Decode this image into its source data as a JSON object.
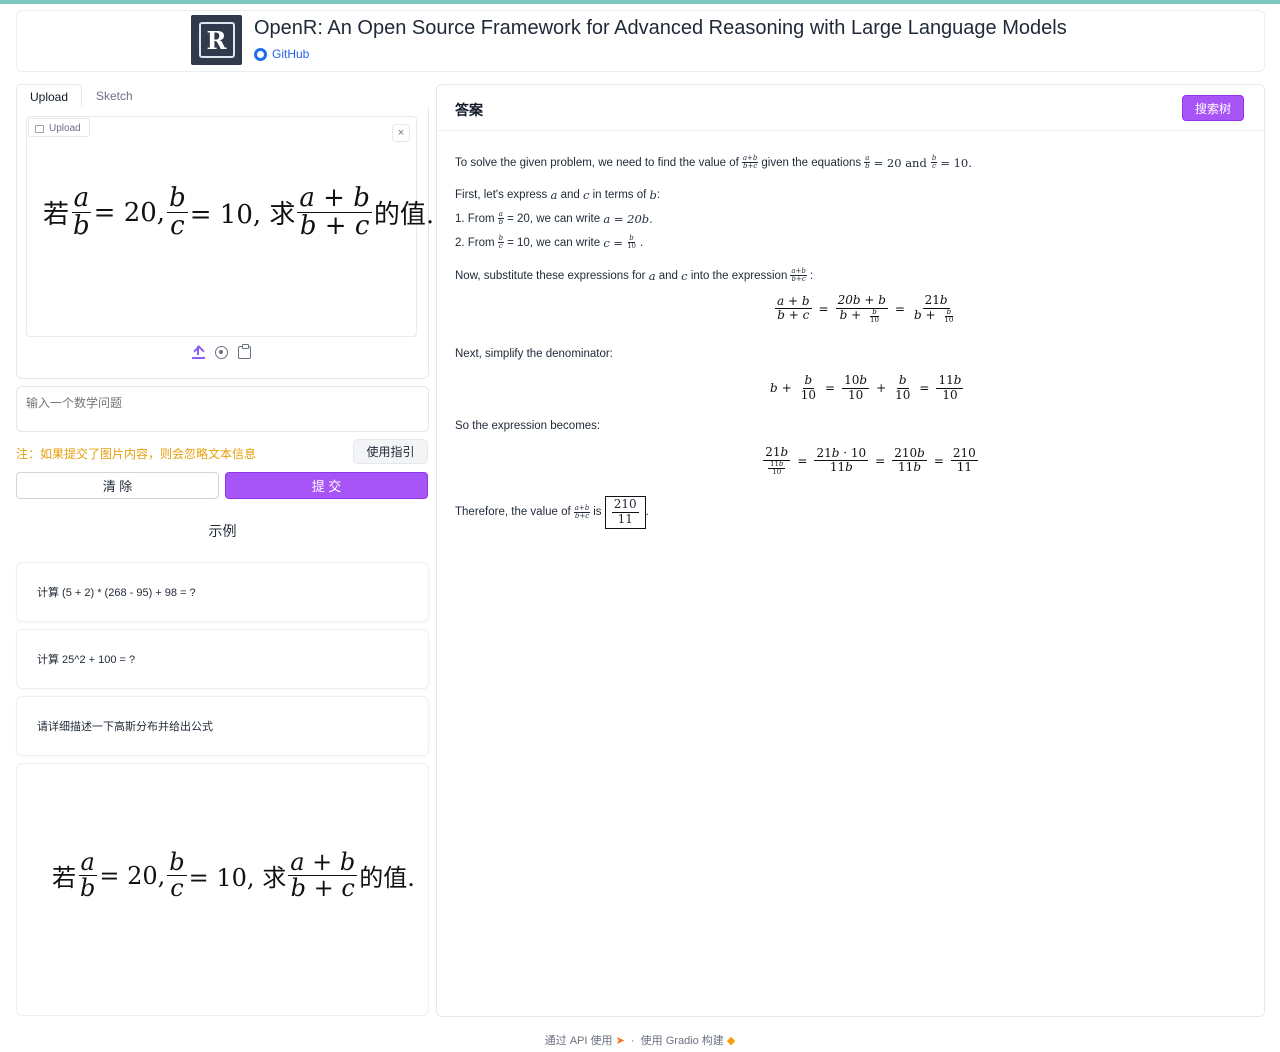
{
  "header": {
    "title": "OpenR: An Open Source Framework for Advanced Reasoning with Large Language Models",
    "github_label": "GitHub",
    "logo_letter": "R"
  },
  "left": {
    "tabs": [
      "Upload",
      "Sketch"
    ],
    "upload_label": "Upload",
    "close_symbol": "×",
    "image_math": {
      "prefix": "若",
      "frac1_num": "a",
      "frac1_den": "b",
      "eq1": "= 20,",
      "frac2_num": "b",
      "frac2_den": "c",
      "eq2": "= 10, 求",
      "frac3_num": "a + b",
      "frac3_den": "b + c",
      "suffix": "的值."
    },
    "question_placeholder": "输入一个数学问题",
    "note": "注：如果提交了图片内容，则会忽略文本信息",
    "guide_button": "使用指引",
    "clear_button": "清 除",
    "submit_button": "提 交",
    "examples_title": "示例",
    "examples": [
      "计算 (5 + 2) * (268 - 95) + 98 = ?",
      "计算 25^2 + 100 = ?",
      "请详细描述一下高斯分布并给出公式"
    ]
  },
  "answer": {
    "title": "答案",
    "tree_button": "搜索树",
    "intro": "To solve the given problem, we need to find the value of",
    "intro_given": "given the equations",
    "intro_eq1": "= 20 and",
    "intro_eq2": "= 10.",
    "first": "First, let's express",
    "first_and": "and",
    "first_terms": "in terms of",
    "first_end": ":",
    "step1_prefix": "1. From",
    "step1_mid": "= 20, we can write",
    "step1_eq": "a = 20b.",
    "step2_prefix": "2. From",
    "step2_mid": "= 10, we can write",
    "step2_eq": "c =",
    "substitute": "Now, substitute these expressions for",
    "substitute_and": "and",
    "substitute_into": "into the expression",
    "simplify": "Next, simplify the denominator:",
    "becomes": "So the expression becomes:",
    "therefore": "Therefore, the value of",
    "therefore_is": "is",
    "final_num": "210",
    "final_den": "11"
  },
  "footer": {
    "api": "通过 API 使用",
    "built": "使用 Gradio 构建"
  },
  "colors": {
    "accent": "#a855f7",
    "note": "#e5a00d",
    "link": "#2563eb"
  }
}
